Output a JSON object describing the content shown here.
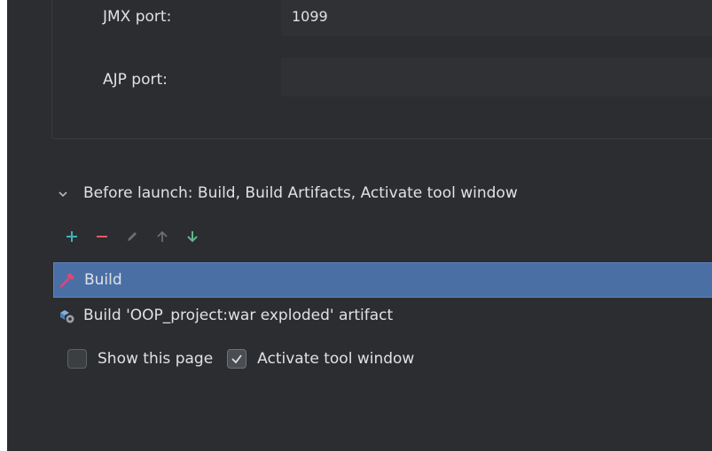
{
  "server": {
    "jmx_label": "JMX port:",
    "jmx_value": "1099",
    "ajp_label": "AJP port:",
    "ajp_value": ""
  },
  "before_launch": {
    "header": "Before launch: Build, Build Artifacts, Activate tool window",
    "toolbar": {
      "add": "add-icon",
      "remove": "remove-icon",
      "edit": "pencil-icon",
      "up": "arrow-up-icon",
      "down": "arrow-down-icon"
    },
    "items": [
      {
        "label": "Build",
        "icon": "hammer-icon",
        "selected": true
      },
      {
        "label": "Build 'OOP_project:war exploded' artifact",
        "icon": "artifact-icon",
        "selected": false
      }
    ]
  },
  "options": {
    "show_page_label": "Show this page",
    "show_page_checked": false,
    "activate_tool_label": "Activate tool window",
    "activate_tool_checked": true
  },
  "colors": {
    "background": "#2b2d30",
    "selection": "#4a6fa5",
    "add": "#3fb2b9",
    "remove": "#e05c6a",
    "down": "#5fb88a",
    "hammer": "#e0457b"
  }
}
